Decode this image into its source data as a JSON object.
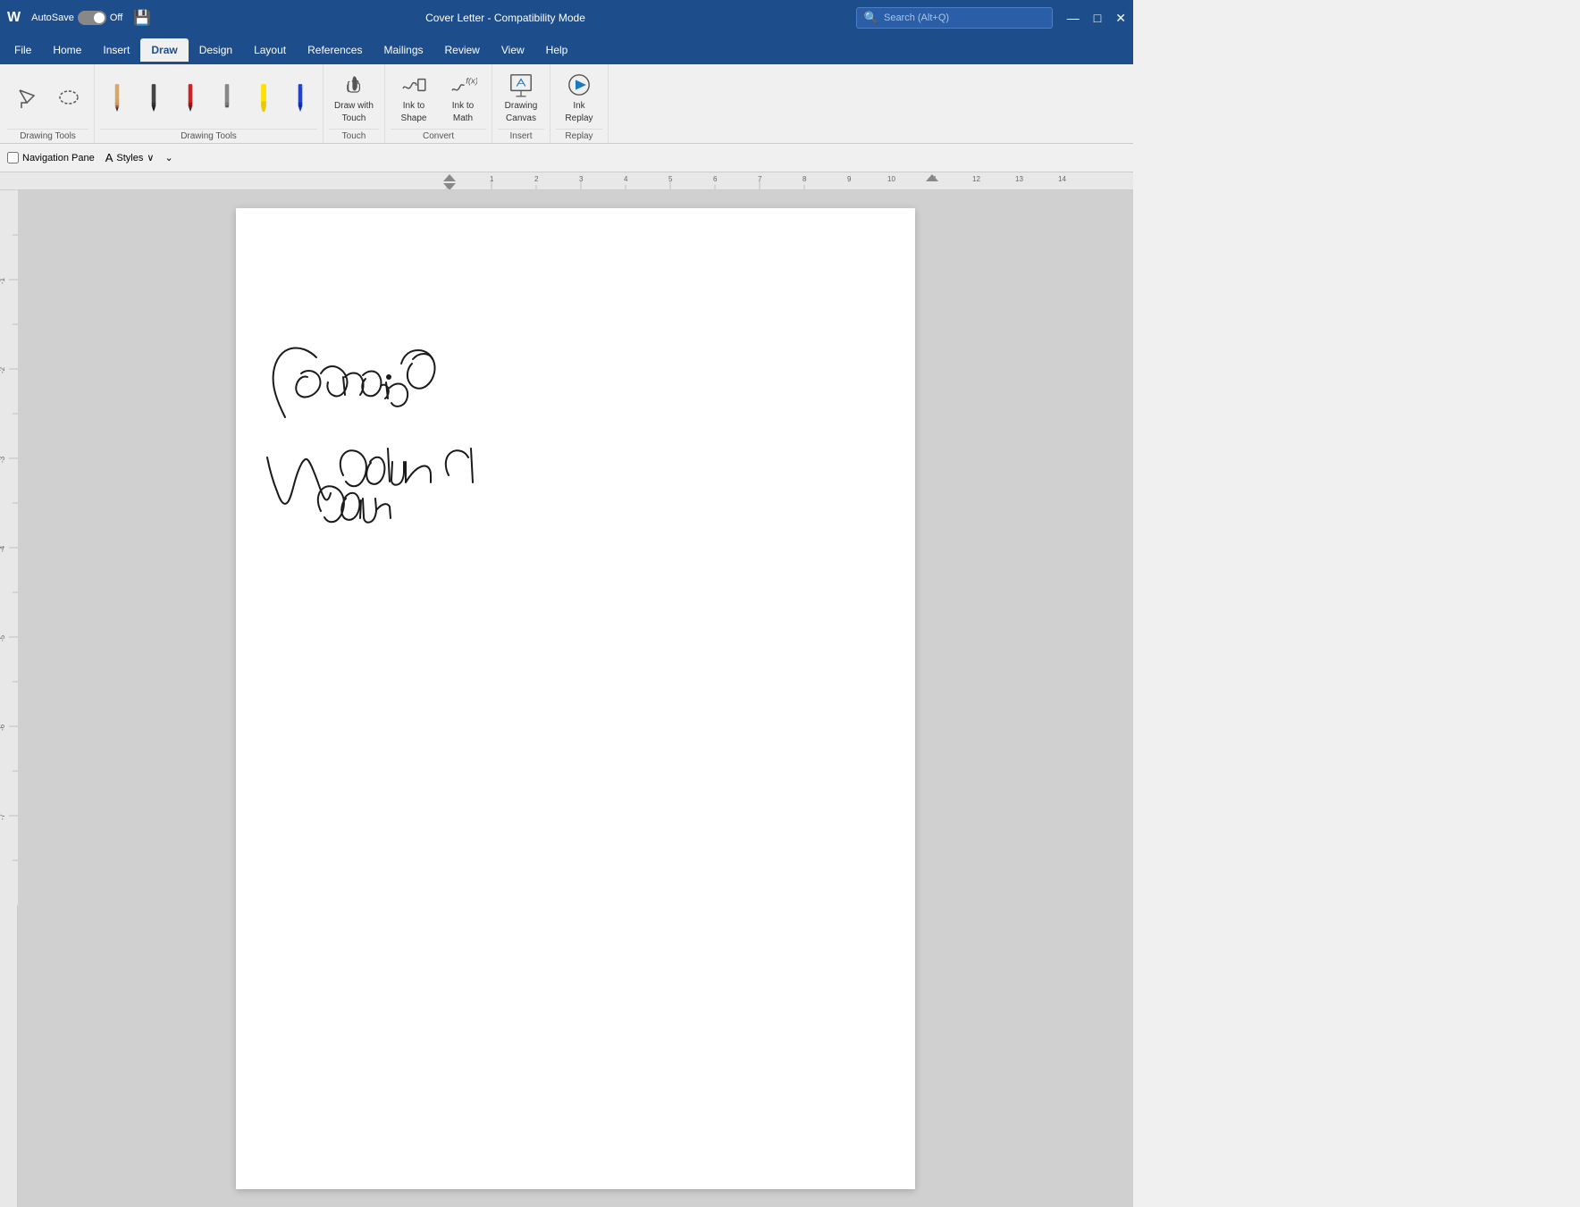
{
  "titlebar": {
    "app": "W",
    "autosave_label": "AutoSave",
    "autosave_state": "Off",
    "doc_title": "Cover Letter  -  Compatibility Mode",
    "search_placeholder": "Search (Alt+Q)"
  },
  "tabs": {
    "items": [
      "File",
      "Home",
      "Insert",
      "Draw",
      "Design",
      "Layout",
      "References",
      "Mailings",
      "Review",
      "View",
      "Help"
    ],
    "active": "Draw"
  },
  "ribbon": {
    "drawing_tools_label": "Drawing Tools",
    "touch_label": "Touch",
    "convert_label": "Convert",
    "insert_label": "Insert",
    "replay_label": "Replay",
    "draw_with_touch_line1": "Draw with",
    "draw_with_touch_line2": "Touch",
    "ink_to_shape_line1": "Ink to",
    "ink_to_shape_line2": "Shape",
    "ink_to_math_line1": "Ink to",
    "ink_to_math_line2": "Math",
    "drawing_canvas_line1": "Drawing",
    "drawing_canvas_line2": "Canvas",
    "ink_replay_line1": "Ink",
    "ink_replay_line2": "Replay"
  },
  "below_ribbon": {
    "nav_pane_label": "Navigation Pane",
    "styles_label": "Styles",
    "extra_dropdown": ""
  }
}
